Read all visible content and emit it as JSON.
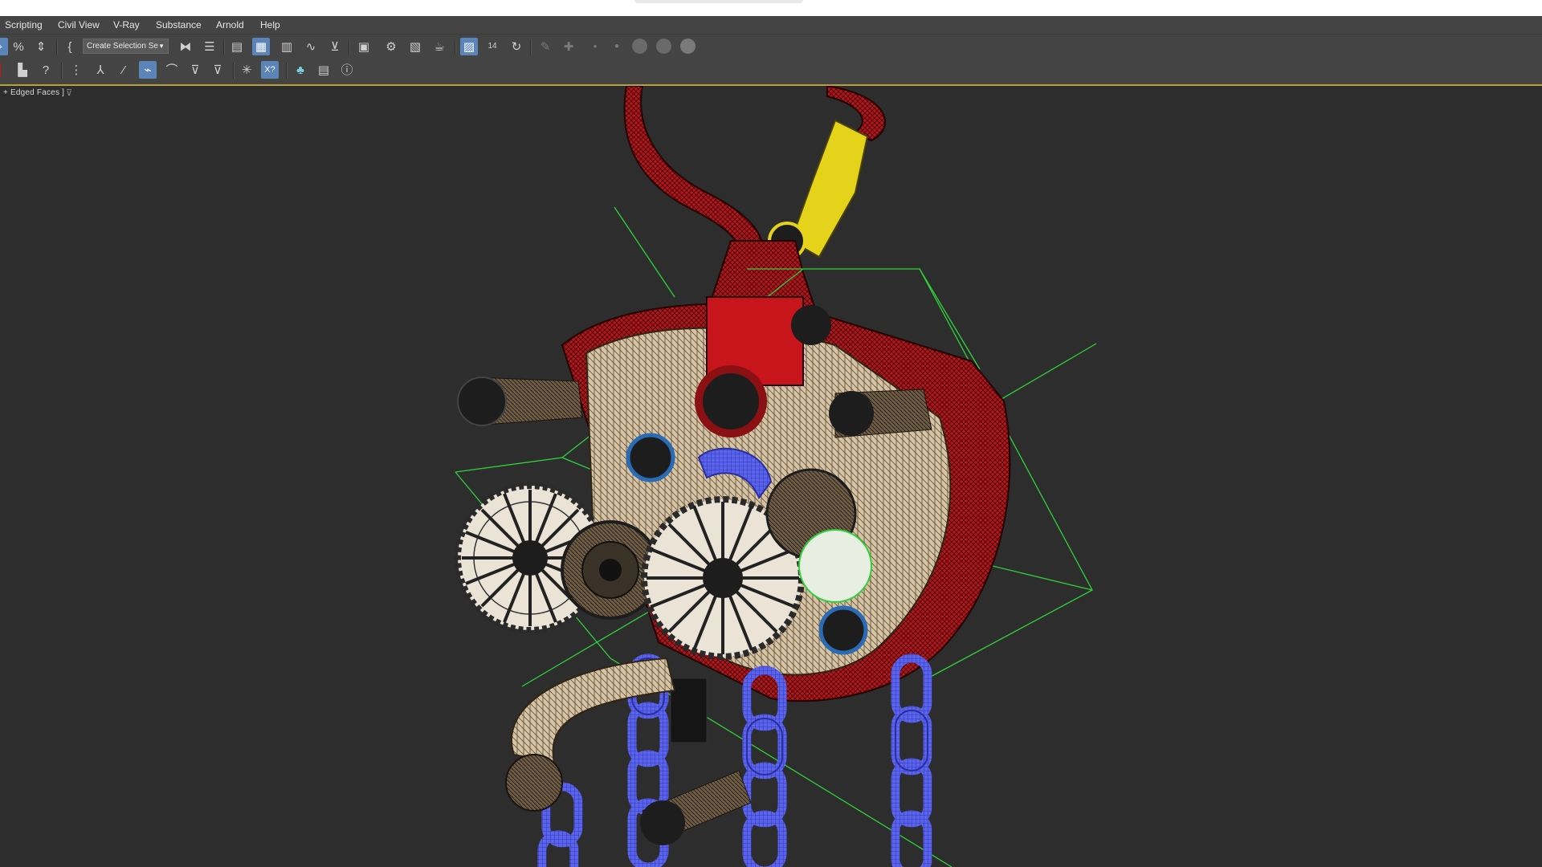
{
  "menubar": {
    "items": [
      "Scripting",
      "Civil View",
      "V-Ray",
      "Substance",
      "Arnold",
      "Help"
    ]
  },
  "toolbar": {
    "selection_set_value": "Create Selection Se",
    "icons_row1": [
      "snap-toggle-icon",
      "percent-snap-icon",
      "spinner-snap-icon",
      "edit-named-selection-icon",
      "mirror-icon",
      "align-icon",
      "scene-explorer-icon",
      "layer-explorer-icon",
      "toggle-ribbon-icon",
      "curve-editor-icon",
      "schematic-view-icon",
      "material-editor-icon",
      "render-setup-icon",
      "rendered-frame-window-icon",
      "render-production-icon",
      "render-iterative-icon",
      "save-icon",
      "counter-14-icon",
      "refresh-icon",
      "tool-icon",
      "plus-icon"
    ],
    "counter_value": "14",
    "icons_row2": [
      "manage-icon",
      "help-icon",
      "grid-icon",
      "bone-icon",
      "link-icon",
      "bind-icon",
      "unlink-icon",
      "spline-icon",
      "filter-icon",
      "spring-icon",
      "xform-icon",
      "tree-icon",
      "list-icon",
      "question-icon"
    ]
  },
  "viewport": {
    "label": "+ Edged Faces ]",
    "colors": {
      "hook": "#b5161b",
      "latch": "#e5d21a",
      "body_red": "#c8151b",
      "gear_face": "#d6c3a3",
      "chain": "#5a63ee",
      "bbox_green": "#2fd13a",
      "background": "#2d2d2d"
    }
  }
}
